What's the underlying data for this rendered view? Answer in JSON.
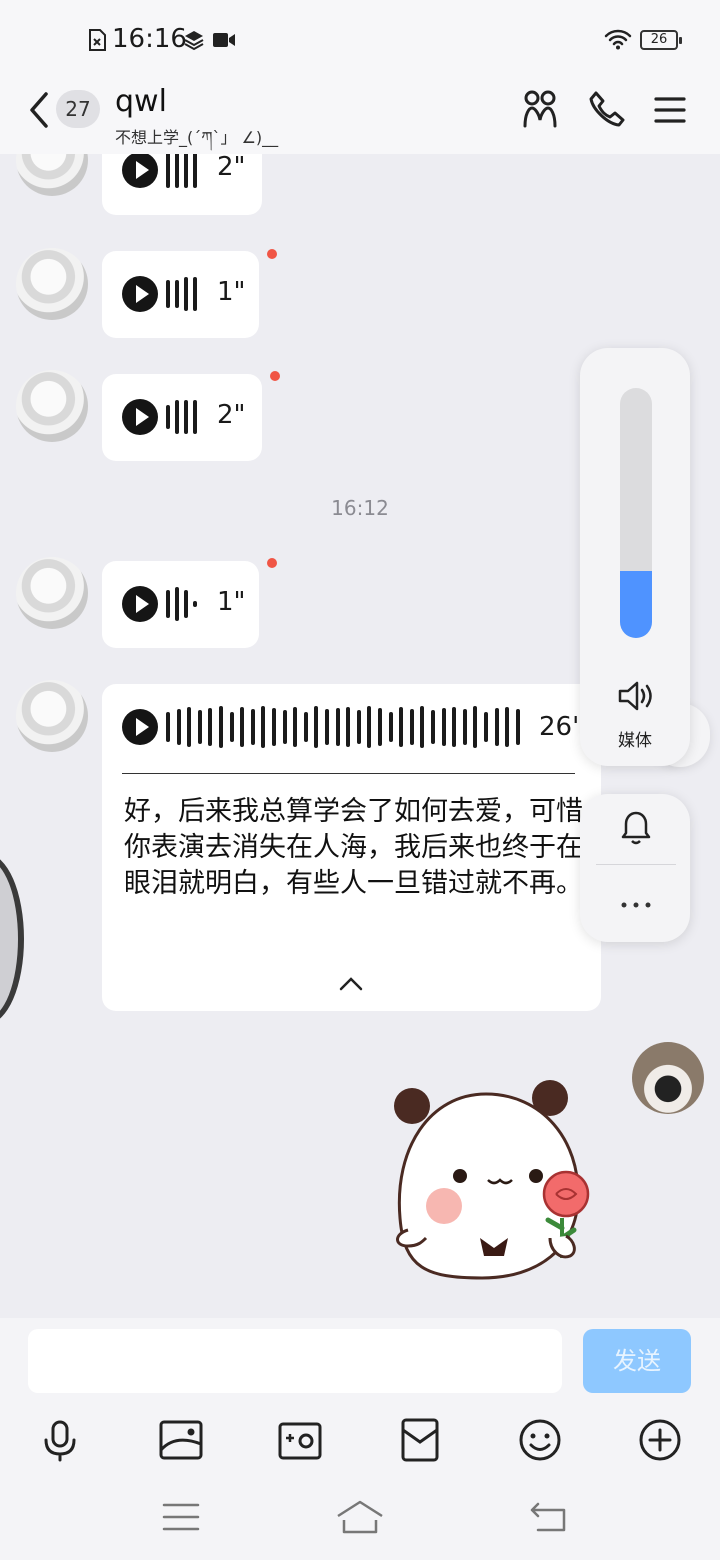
{
  "status_bar": {
    "time": "16:16",
    "battery": "26"
  },
  "header": {
    "unread_count": "27",
    "name": "qwl",
    "subtitle": "不想上学_(´ཀ`」 ∠)__"
  },
  "messages": [
    {
      "kind": "voice",
      "duration": "2\""
    },
    {
      "kind": "voice",
      "duration": "1\""
    },
    {
      "kind": "voice",
      "duration": "2\""
    },
    {
      "kind": "time",
      "text": "16:12"
    },
    {
      "kind": "voice",
      "duration": "1\""
    },
    {
      "kind": "voice",
      "duration": "26'",
      "transcript": "好，后来我总算学会了如何去爱，可惜你表演去消失在人海，我后来也终于在眼泪就明白，有些人一旦错过就不再。"
    }
  ],
  "volume_overlay": {
    "label": "媒体",
    "level": 0.27
  },
  "input": {
    "placeholder": "",
    "send_label": "发送"
  },
  "toolbar": [
    "mic-icon",
    "image-icon",
    "camera-icon",
    "red-packet-icon",
    "emoji-icon",
    "plus-icon"
  ],
  "colors": {
    "accent": "#8ec8ff",
    "volume_fill": "#4f93ff",
    "unread_dot": "#f05545"
  }
}
